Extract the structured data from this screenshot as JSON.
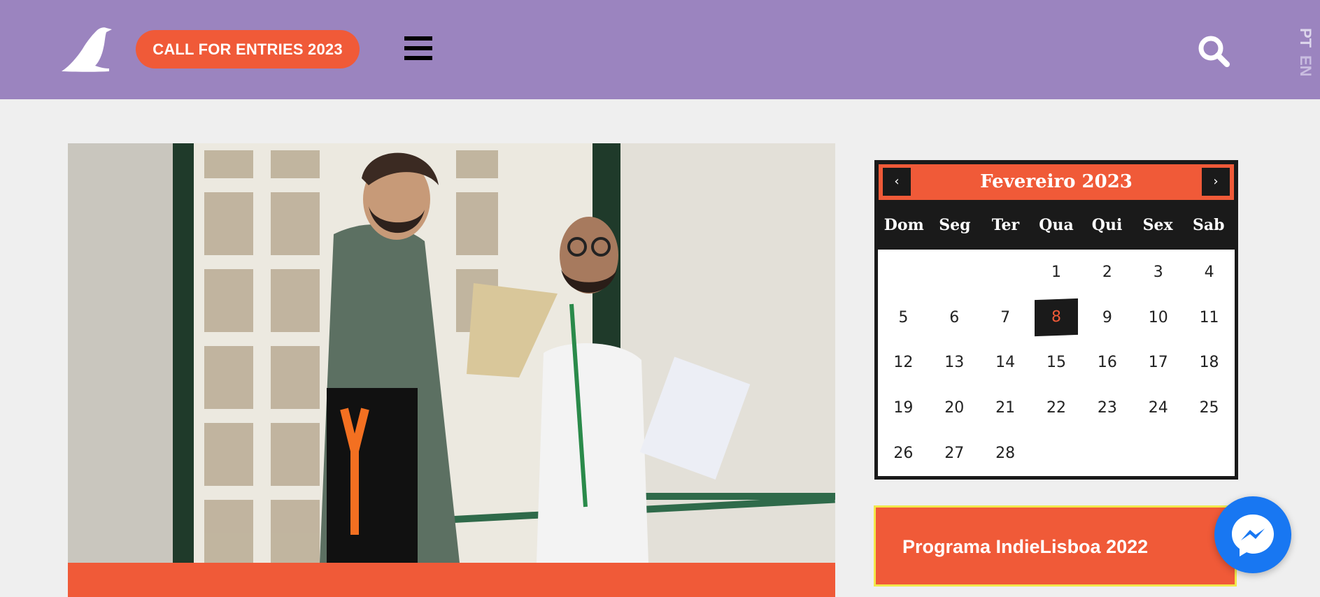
{
  "header": {
    "cta_label": "CALL FOR ENTRIES 2023",
    "languages": [
      "PT",
      "EN"
    ]
  },
  "calendar": {
    "month_title": "Fevereiro 2023",
    "weekdays": [
      "Dom",
      "Seg",
      "Ter",
      "Qua",
      "Qui",
      "Sex",
      "Sab"
    ],
    "days": [
      "",
      "",
      "",
      "1",
      "2",
      "3",
      "4",
      "5",
      "6",
      "7",
      "8",
      "9",
      "10",
      "11",
      "12",
      "13",
      "14",
      "15",
      "16",
      "17",
      "18",
      "19",
      "20",
      "21",
      "22",
      "23",
      "24",
      "25",
      "26",
      "27",
      "28",
      "",
      "",
      "",
      ""
    ],
    "highlighted_day": "8"
  },
  "sidebar": {
    "programa_label": "Programa IndieLisboa 2022"
  },
  "colors": {
    "header_bg": "#9b84bf",
    "accent": "#f05a38",
    "page_bg": "#efefef",
    "messenger": "#1877f2"
  },
  "icons": [
    "bird-logo-icon",
    "hamburger-menu-icon",
    "search-icon",
    "chevron-left-icon",
    "chevron-right-icon",
    "messenger-icon"
  ]
}
